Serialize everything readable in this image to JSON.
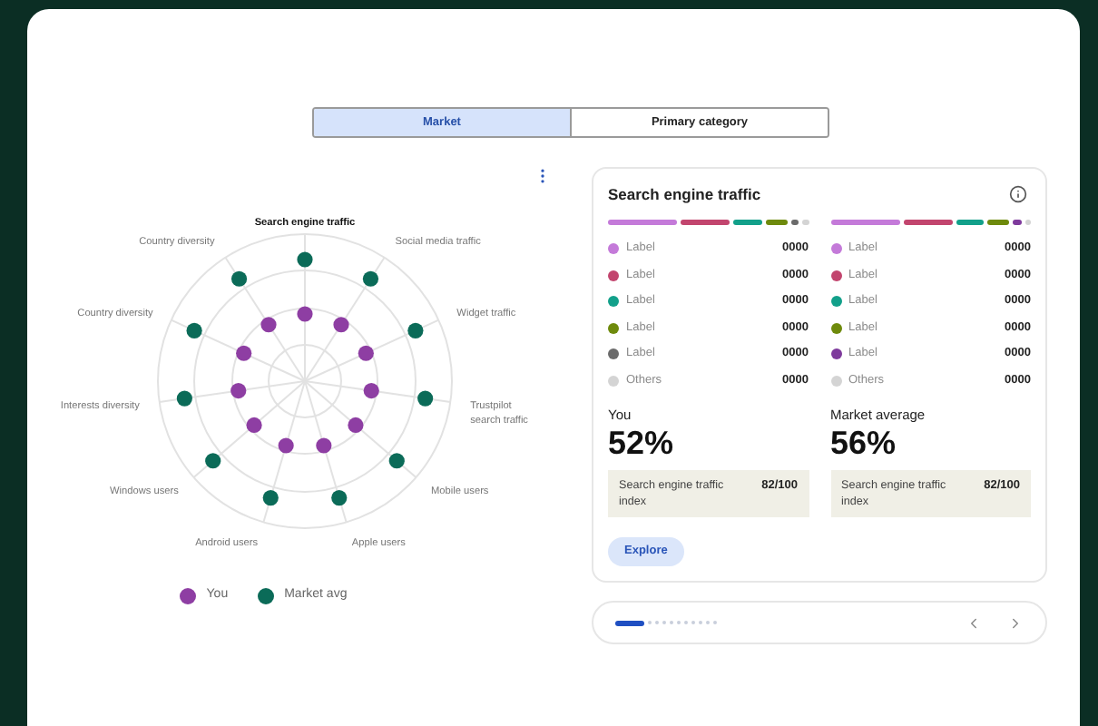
{
  "tabs": [
    {
      "label": "Market",
      "selected": true
    },
    {
      "label": "Primary category",
      "selected": false
    }
  ],
  "radar": {
    "right_axes": [
      {
        "lines": [
          "Search engine traffic"
        ],
        "highlighted": true
      },
      {
        "lines": [
          "Social media traffic"
        ],
        "highlighted": false
      },
      {
        "lines": [
          "Widget traffic"
        ],
        "highlighted": false
      },
      {
        "lines": [
          "Trustpilot",
          "search traffic"
        ],
        "highlighted": false
      },
      {
        "lines": [
          "Mobile users"
        ],
        "highlighted": false
      },
      {
        "lines": [
          "Apple users"
        ],
        "highlighted": false
      }
    ],
    "left_axes": [
      {
        "lines": [
          "Country diversity"
        ],
        "highlighted": false
      },
      {
        "lines": [
          "Country diversity"
        ],
        "highlighted": false
      },
      {
        "lines": [
          "Interests diversity"
        ],
        "highlighted": false
      },
      {
        "lines": [
          "Windows users"
        ],
        "highlighted": false
      },
      {
        "lines": [
          "Android users"
        ],
        "highlighted": false
      }
    ],
    "legend": [
      {
        "label": "You",
        "color": "#8e3ea3"
      },
      {
        "label": "Market avg",
        "color": "#0b6b58"
      }
    ]
  },
  "card": {
    "title": "Search engine traffic",
    "columns": [
      {
        "items": [
          {
            "label": "Label",
            "value": "0000",
            "color": "#c47ad9"
          },
          {
            "label": "Label",
            "value": "0000",
            "color": "#c2456e"
          },
          {
            "label": "Label",
            "value": "0000",
            "color": "#12a08a"
          },
          {
            "label": "Label",
            "value": "0000",
            "color": "#6e8a0c"
          },
          {
            "label": "Label",
            "value": "0000",
            "color": "#6b6b6b"
          },
          {
            "label": "Others",
            "value": "0000",
            "color": "#d4d4d4"
          }
        ],
        "caption": "You",
        "percent": "52%",
        "index_label": "Search engine traffic index",
        "index_value": "82/100"
      },
      {
        "items": [
          {
            "label": "Label",
            "value": "0000",
            "color": "#c47ad9"
          },
          {
            "label": "Label",
            "value": "0000",
            "color": "#c2456e"
          },
          {
            "label": "Label",
            "value": "0000",
            "color": "#12a08a"
          },
          {
            "label": "Label",
            "value": "0000",
            "color": "#6e8a0c"
          },
          {
            "label": "Label",
            "value": "0000",
            "color": "#7e3a9c"
          },
          {
            "label": "Others",
            "value": "0000",
            "color": "#d4d4d4"
          }
        ],
        "caption": "Market average",
        "percent": "56%",
        "index_label": "Search engine traffic index",
        "index_value": "82/100"
      }
    ],
    "button": "Explore"
  },
  "pager": {
    "pages": [
      {
        "selected": true
      },
      {
        "selected": false
      },
      {
        "selected": false
      },
      {
        "selected": false
      },
      {
        "selected": false
      },
      {
        "selected": false
      },
      {
        "selected": false
      },
      {
        "selected": false
      },
      {
        "selected": false
      },
      {
        "selected": false
      },
      {
        "selected": false
      }
    ]
  }
}
